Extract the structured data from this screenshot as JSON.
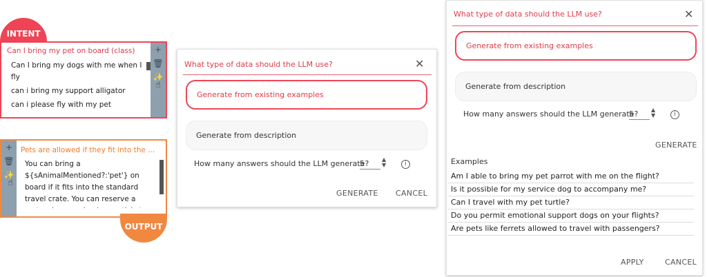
{
  "intent": {
    "badge": "INTENT",
    "title": "Can I bring my pet on board (class)",
    "items": [
      "Can I bring my dogs with me when I fly",
      "can i bring my support alligator",
      "can i please fly with my pet"
    ],
    "icons": [
      "plus-icon",
      "trash-icon",
      "magic-wand-icon"
    ]
  },
  "output": {
    "badge": "OUTPUT",
    "title": "Pets are allowed if they fit into the ...",
    "text": "You can bring a ${sAnimalMentioned?:'pet'} on board if it fits into the standard travel crate. You can reserve a crate when you book your ticket"
  },
  "dialog_small": {
    "title": "What type of data should the LLM use?",
    "option_1": "Generate from existing examples",
    "option_2": "Generate from description",
    "count_label": "How many answers should the LLM generate?",
    "count_value": "5",
    "generate": "GENERATE",
    "cancel": "CANCEL"
  },
  "dialog_large": {
    "title": "What type of data should the LLM use?",
    "option_1": "Generate from existing examples",
    "option_2": "Generate from description",
    "count_label": "How many answers should the LLM generate?",
    "count_value": "5",
    "generate": "GENERATE",
    "examples_heading": "Examples",
    "examples": [
      "Am I able to bring my pet parrot with me on the flight?",
      "Is it possible for my service dog to accompany me?",
      "Can I travel with my pet turtle?",
      "Do you permit emotional support dogs on your flights?",
      "Are pets like ferrets allowed to travel with passengers?"
    ],
    "apply": "APPLY",
    "cancel": "CANCEL"
  },
  "colors": {
    "intent_accent": "#ee4455",
    "output_accent": "#f08840",
    "sidebar": "#8ea0ae"
  }
}
